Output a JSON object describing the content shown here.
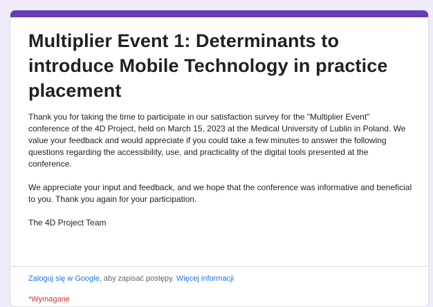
{
  "theme": {
    "accent": "#673ab7",
    "background": "#f0ebf8",
    "link": "#1a73e8",
    "required": "#d93025"
  },
  "form": {
    "title": "Multiplier Event 1: Determinants to introduce Mobile Technology in practice placement",
    "description": [
      "Thank you for taking the time to participate in our satisfaction survey for the \"Multiplier Event\" conference of the 4D Project, held on March 15, 2023 at the Medical University of Lublin in Poland. We value your feedback and would appreciate if you could take a few minutes to answer the following questions regarding the accessibility, use, and practicality of the digital tools presented at the conference.",
      "",
      "We appreciate your input and feedback, and we hope that the conference was informative and beneficial to you. Thank you again for your participation.",
      "",
      "The 4D Project Team"
    ]
  },
  "footer": {
    "signin_link": "Zaloguj się w Google",
    "signin_text": ", aby zapisać postępy.",
    "more_info_link": "Więcej informacji",
    "required_note": "*Wymagane"
  }
}
